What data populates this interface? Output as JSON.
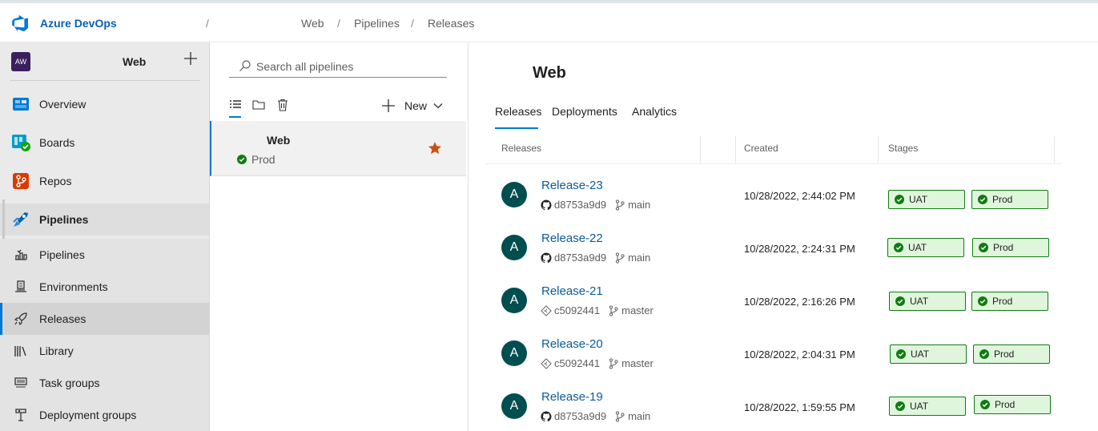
{
  "header": {
    "brand": "Azure DevOps",
    "separator": "/",
    "breadcrumb": [
      "Web",
      "Pipelines",
      "Releases"
    ]
  },
  "sidebar": {
    "project_initials": "AW",
    "project_name": "Web",
    "items": [
      {
        "label": "Overview",
        "icon": "overview-icon"
      },
      {
        "label": "Boards",
        "icon": "boards-icon"
      },
      {
        "label": "Repos",
        "icon": "repos-icon"
      },
      {
        "label": "Pipelines",
        "icon": "pipelines-icon"
      },
      {
        "label": "Pipelines",
        "icon": "pipelines-sub-icon"
      },
      {
        "label": "Environments",
        "icon": "environments-icon"
      },
      {
        "label": "Releases",
        "icon": "rocket-icon"
      },
      {
        "label": "Library",
        "icon": "library-icon"
      },
      {
        "label": "Task groups",
        "icon": "task-groups-icon"
      },
      {
        "label": "Deployment groups",
        "icon": "deployment-groups-icon"
      }
    ]
  },
  "middle": {
    "search_placeholder": "Search all pipelines",
    "new_label": "New",
    "pipeline": {
      "name": "Web",
      "status": "Prod",
      "favorite": true
    }
  },
  "main": {
    "title": "Web",
    "tabs": [
      "Releases",
      "Deployments",
      "Analytics"
    ],
    "columns": [
      "Releases",
      "Created",
      "Stages"
    ],
    "releases": [
      {
        "avatar": "A",
        "name": "Release-23",
        "commit": "d8753a9d9",
        "source": "github",
        "branch": "main",
        "created": "10/28/2022, 2:44:02 PM",
        "stages": [
          "UAT",
          "Prod"
        ]
      },
      {
        "avatar": "A",
        "name": "Release-22",
        "commit": "d8753a9d9",
        "source": "github",
        "branch": "main",
        "created": "10/28/2022, 2:24:31 PM",
        "stages": [
          "UAT",
          "Prod"
        ]
      },
      {
        "avatar": "A",
        "name": "Release-21",
        "commit": "c5092441",
        "source": "azure-repos",
        "branch": "master",
        "created": "10/28/2022, 2:16:26 PM",
        "stages": [
          "UAT",
          "Prod"
        ]
      },
      {
        "avatar": "A",
        "name": "Release-20",
        "commit": "c5092441",
        "source": "azure-repos",
        "branch": "master",
        "created": "10/28/2022, 2:04:31 PM",
        "stages": [
          "UAT",
          "Prod"
        ]
      },
      {
        "avatar": "A",
        "name": "Release-19",
        "commit": "d8753a9d9",
        "source": "github",
        "branch": "main",
        "created": "10/28/2022, 1:59:55 PM",
        "stages": [
          "UAT",
          "Prod"
        ]
      }
    ]
  },
  "colors": {
    "accent": "#0078d4",
    "stage_success_bg": "#dff6dd",
    "stage_success_border": "#107c10",
    "avatar": "#004e4f",
    "favorite_star": "#ca5010"
  }
}
